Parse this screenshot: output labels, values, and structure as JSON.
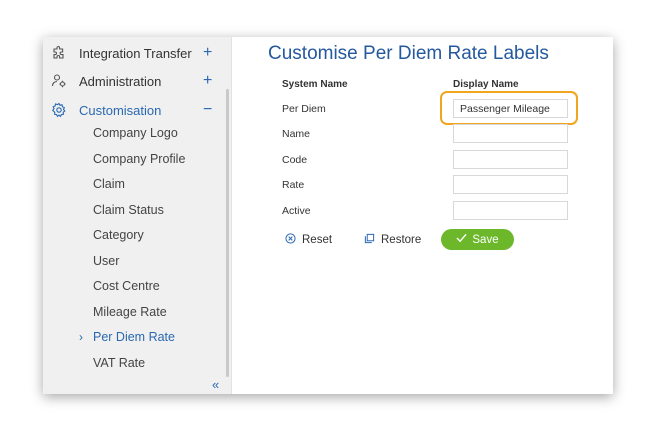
{
  "sidebar": {
    "items": [
      {
        "label": "Integration Transfer",
        "icon": "puzzle-icon",
        "toggle": "+"
      },
      {
        "label": "Administration",
        "icon": "user-gear-icon",
        "toggle": "+"
      },
      {
        "label": "Customisation",
        "icon": "gear-icon",
        "toggle": "−"
      }
    ],
    "subitems": [
      "Company Logo",
      "Company Profile",
      "Claim",
      "Claim Status",
      "Category",
      "User",
      "Cost Centre",
      "Mileage Rate",
      "Per Diem Rate",
      "VAT Rate"
    ],
    "selected_chevron": "›",
    "collapse_glyph": "«"
  },
  "main": {
    "title": "Customise Per Diem Rate Labels",
    "col_system": "System Name",
    "col_display": "Display Name",
    "rows": [
      {
        "system": "Per Diem",
        "display": "Passenger Mileage"
      },
      {
        "system": "Name",
        "display": ""
      },
      {
        "system": "Code",
        "display": ""
      },
      {
        "system": "Rate",
        "display": ""
      },
      {
        "system": "Active",
        "display": ""
      }
    ],
    "reset_label": "Reset",
    "restore_label": "Restore",
    "save_label": "Save"
  },
  "colors": {
    "accent": "#2a68b0",
    "highlight": "#f2a51e",
    "save": "#6cb82a"
  }
}
